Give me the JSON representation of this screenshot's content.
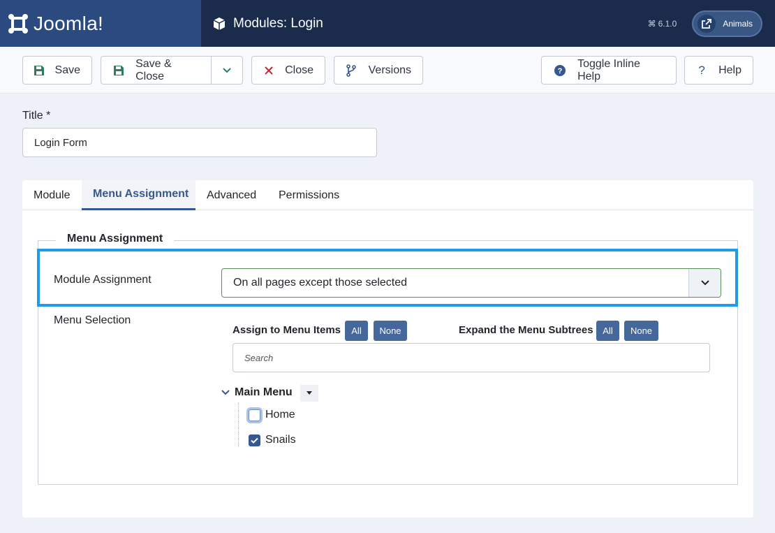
{
  "header": {
    "brand": "Joomla!",
    "page_title": "Modules: Login",
    "version": "6.1.0",
    "site_label": "Animals"
  },
  "toolbar": {
    "save": "Save",
    "save_close": "Save & Close",
    "close": "Close",
    "versions": "Versions",
    "toggle_help": "Toggle Inline Help",
    "help": "Help"
  },
  "form": {
    "title_label": "Title *",
    "title_value": "Login Form"
  },
  "tabs": [
    "Module",
    "Menu Assignment",
    "Advanced",
    "Permissions"
  ],
  "menu_assignment": {
    "legend": "Menu Assignment",
    "module_assignment_label": "Module Assignment",
    "module_assignment_value": "On all pages except those selected",
    "menu_selection_label": "Menu Selection",
    "assign_title": "Assign to Menu Items",
    "expand_title": "Expand the Menu Subtrees",
    "all": "All",
    "none": "None",
    "search_placeholder": "Search",
    "tree_root": "Main Menu",
    "items": [
      {
        "label": "Home",
        "checked": false
      },
      {
        "label": "Snails",
        "checked": true
      }
    ]
  },
  "colors": {
    "header": "#1a2b4c",
    "brand_bg": "#2b4a80",
    "accent": "#36578f",
    "highlight": "#1f9ce8",
    "save_icon": "#2f7d5b",
    "close_icon": "#c5262e"
  }
}
